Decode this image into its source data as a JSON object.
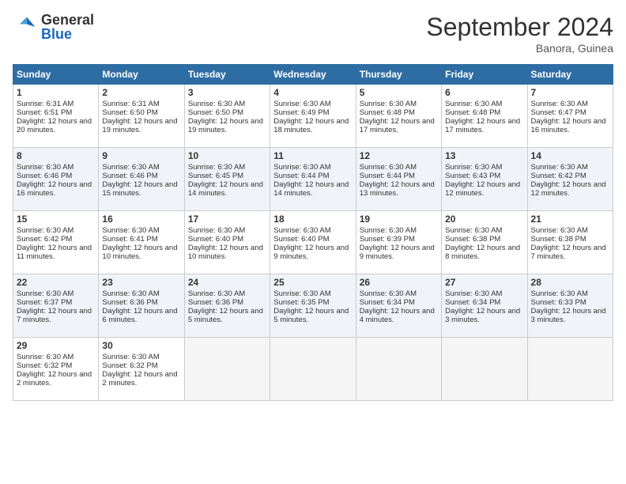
{
  "logo": {
    "general": "General",
    "blue": "Blue"
  },
  "title": "September 2024",
  "location": "Banora, Guinea",
  "days_header": [
    "Sunday",
    "Monday",
    "Tuesday",
    "Wednesday",
    "Thursday",
    "Friday",
    "Saturday"
  ],
  "weeks": [
    [
      {
        "day": "1",
        "sunrise": "6:31 AM",
        "sunset": "6:51 PM",
        "daylight": "12 hours and 20 minutes."
      },
      {
        "day": "2",
        "sunrise": "6:31 AM",
        "sunset": "6:50 PM",
        "daylight": "12 hours and 19 minutes."
      },
      {
        "day": "3",
        "sunrise": "6:30 AM",
        "sunset": "6:50 PM",
        "daylight": "12 hours and 19 minutes."
      },
      {
        "day": "4",
        "sunrise": "6:30 AM",
        "sunset": "6:49 PM",
        "daylight": "12 hours and 18 minutes."
      },
      {
        "day": "5",
        "sunrise": "6:30 AM",
        "sunset": "6:48 PM",
        "daylight": "12 hours and 17 minutes."
      },
      {
        "day": "6",
        "sunrise": "6:30 AM",
        "sunset": "6:48 PM",
        "daylight": "12 hours and 17 minutes."
      },
      {
        "day": "7",
        "sunrise": "6:30 AM",
        "sunset": "6:47 PM",
        "daylight": "12 hours and 16 minutes."
      }
    ],
    [
      {
        "day": "8",
        "sunrise": "6:30 AM",
        "sunset": "6:46 PM",
        "daylight": "12 hours and 16 minutes."
      },
      {
        "day": "9",
        "sunrise": "6:30 AM",
        "sunset": "6:46 PM",
        "daylight": "12 hours and 15 minutes."
      },
      {
        "day": "10",
        "sunrise": "6:30 AM",
        "sunset": "6:45 PM",
        "daylight": "12 hours and 14 minutes."
      },
      {
        "day": "11",
        "sunrise": "6:30 AM",
        "sunset": "6:44 PM",
        "daylight": "12 hours and 14 minutes."
      },
      {
        "day": "12",
        "sunrise": "6:30 AM",
        "sunset": "6:44 PM",
        "daylight": "12 hours and 13 minutes."
      },
      {
        "day": "13",
        "sunrise": "6:30 AM",
        "sunset": "6:43 PM",
        "daylight": "12 hours and 12 minutes."
      },
      {
        "day": "14",
        "sunrise": "6:30 AM",
        "sunset": "6:42 PM",
        "daylight": "12 hours and 12 minutes."
      }
    ],
    [
      {
        "day": "15",
        "sunrise": "6:30 AM",
        "sunset": "6:42 PM",
        "daylight": "12 hours and 11 minutes."
      },
      {
        "day": "16",
        "sunrise": "6:30 AM",
        "sunset": "6:41 PM",
        "daylight": "12 hours and 10 minutes."
      },
      {
        "day": "17",
        "sunrise": "6:30 AM",
        "sunset": "6:40 PM",
        "daylight": "12 hours and 10 minutes."
      },
      {
        "day": "18",
        "sunrise": "6:30 AM",
        "sunset": "6:40 PM",
        "daylight": "12 hours and 9 minutes."
      },
      {
        "day": "19",
        "sunrise": "6:30 AM",
        "sunset": "6:39 PM",
        "daylight": "12 hours and 9 minutes."
      },
      {
        "day": "20",
        "sunrise": "6:30 AM",
        "sunset": "6:38 PM",
        "daylight": "12 hours and 8 minutes."
      },
      {
        "day": "21",
        "sunrise": "6:30 AM",
        "sunset": "6:38 PM",
        "daylight": "12 hours and 7 minutes."
      }
    ],
    [
      {
        "day": "22",
        "sunrise": "6:30 AM",
        "sunset": "6:37 PM",
        "daylight": "12 hours and 7 minutes."
      },
      {
        "day": "23",
        "sunrise": "6:30 AM",
        "sunset": "6:36 PM",
        "daylight": "12 hours and 6 minutes."
      },
      {
        "day": "24",
        "sunrise": "6:30 AM",
        "sunset": "6:36 PM",
        "daylight": "12 hours and 5 minutes."
      },
      {
        "day": "25",
        "sunrise": "6:30 AM",
        "sunset": "6:35 PM",
        "daylight": "12 hours and 5 minutes."
      },
      {
        "day": "26",
        "sunrise": "6:30 AM",
        "sunset": "6:34 PM",
        "daylight": "12 hours and 4 minutes."
      },
      {
        "day": "27",
        "sunrise": "6:30 AM",
        "sunset": "6:34 PM",
        "daylight": "12 hours and 3 minutes."
      },
      {
        "day": "28",
        "sunrise": "6:30 AM",
        "sunset": "6:33 PM",
        "daylight": "12 hours and 3 minutes."
      }
    ],
    [
      {
        "day": "29",
        "sunrise": "6:30 AM",
        "sunset": "6:32 PM",
        "daylight": "12 hours and 2 minutes."
      },
      {
        "day": "30",
        "sunrise": "6:30 AM",
        "sunset": "6:32 PM",
        "daylight": "12 hours and 2 minutes."
      },
      null,
      null,
      null,
      null,
      null
    ]
  ]
}
